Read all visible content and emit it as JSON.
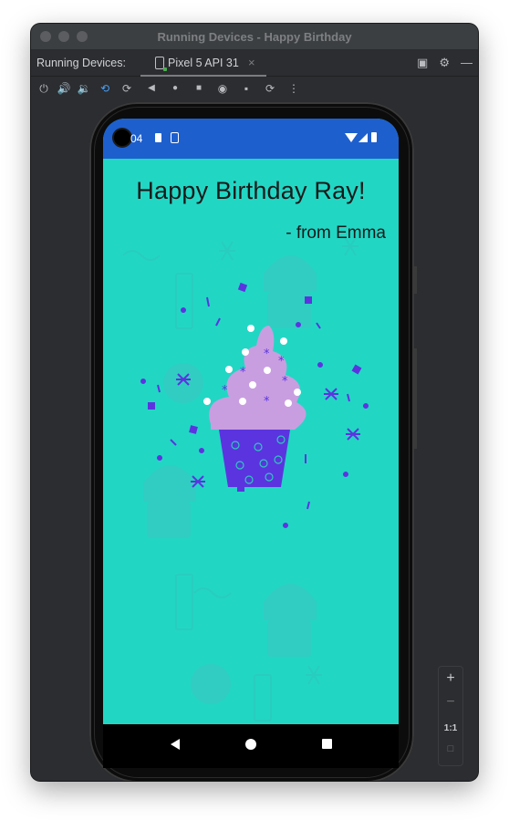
{
  "window": {
    "title": "Running Devices - Happy Birthday"
  },
  "tabs": {
    "label": "Running Devices:",
    "active_tab": "Pixel 5 API 31",
    "close": "×"
  },
  "toolbar": {
    "icons": [
      "power-icon",
      "volume-up-icon",
      "volume-down-icon",
      "rotate-left-icon",
      "rotate-right-icon",
      "back-icon",
      "home-icon",
      "overview-icon",
      "screenshot-icon",
      "screen-record-icon",
      "snapshot-icon",
      "more-icon"
    ]
  },
  "status": {
    "time": "04"
  },
  "app": {
    "greeting": "Happy Birthday Ray!",
    "signature": "- from Emma"
  },
  "zoom": {
    "plus": "+",
    "minus": "−",
    "actual": "1:1"
  },
  "colors": {
    "background": "#22d6c4",
    "status_bar": "#1e5fce",
    "cupcake_frosting": "#c99ee0",
    "cupcake_wrapper": "#5b34e0"
  }
}
